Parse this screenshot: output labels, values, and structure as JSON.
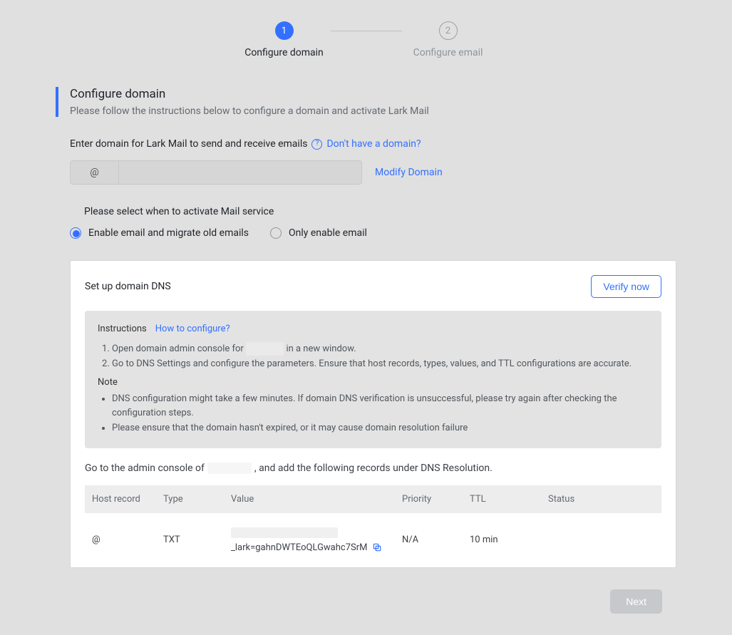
{
  "stepper": {
    "step1_num": "1",
    "step1_label": "Configure domain",
    "step2_num": "2",
    "step2_label": "Configure email"
  },
  "header": {
    "title": "Configure domain",
    "subtitle": "Please follow the instructions below to configure a domain and activate Lark Mail"
  },
  "domain": {
    "label": "Enter domain for Lark Mail to send and receive emails",
    "help_link": "Don't have a domain?",
    "prefix": "@",
    "value": "",
    "modify": "Modify Domain"
  },
  "activation": {
    "label": "Please select when to activate Mail service",
    "opt1": "Enable email and migrate old emails",
    "opt2": "Only enable email",
    "selected": "opt1"
  },
  "dns": {
    "title": "Set up domain DNS",
    "verify": "Verify now",
    "instructions_label": "Instructions",
    "how_link": "How to configure?",
    "step1_a": "Open domain admin console for ",
    "step1_b": " in a new window.",
    "step2": "Go to DNS Settings and configure the parameters. Ensure that host records, types, values, and TTL configurations are accurate.",
    "note_label": "Note",
    "note1": "DNS configuration might take a few minutes. If domain DNS verification is unsuccessful, please try again after checking the configuration steps.",
    "note2": "Please ensure that the domain hasn't expired, or it may cause domain resolution failure",
    "records_caption_a": "Go to the admin console of ",
    "records_caption_b": ", and add the following records under DNS Resolution.",
    "cols": {
      "host": "Host record",
      "type": "Type",
      "value": "Value",
      "priority": "Priority",
      "ttl": "TTL",
      "status": "Status"
    },
    "row": {
      "host": "@",
      "type": "TXT",
      "value_suffix": "_lark=gahnDWTEoQLGwahc7SrM",
      "priority": "N/A",
      "ttl": "10 min",
      "status": ""
    }
  },
  "footer": {
    "next": "Next"
  }
}
